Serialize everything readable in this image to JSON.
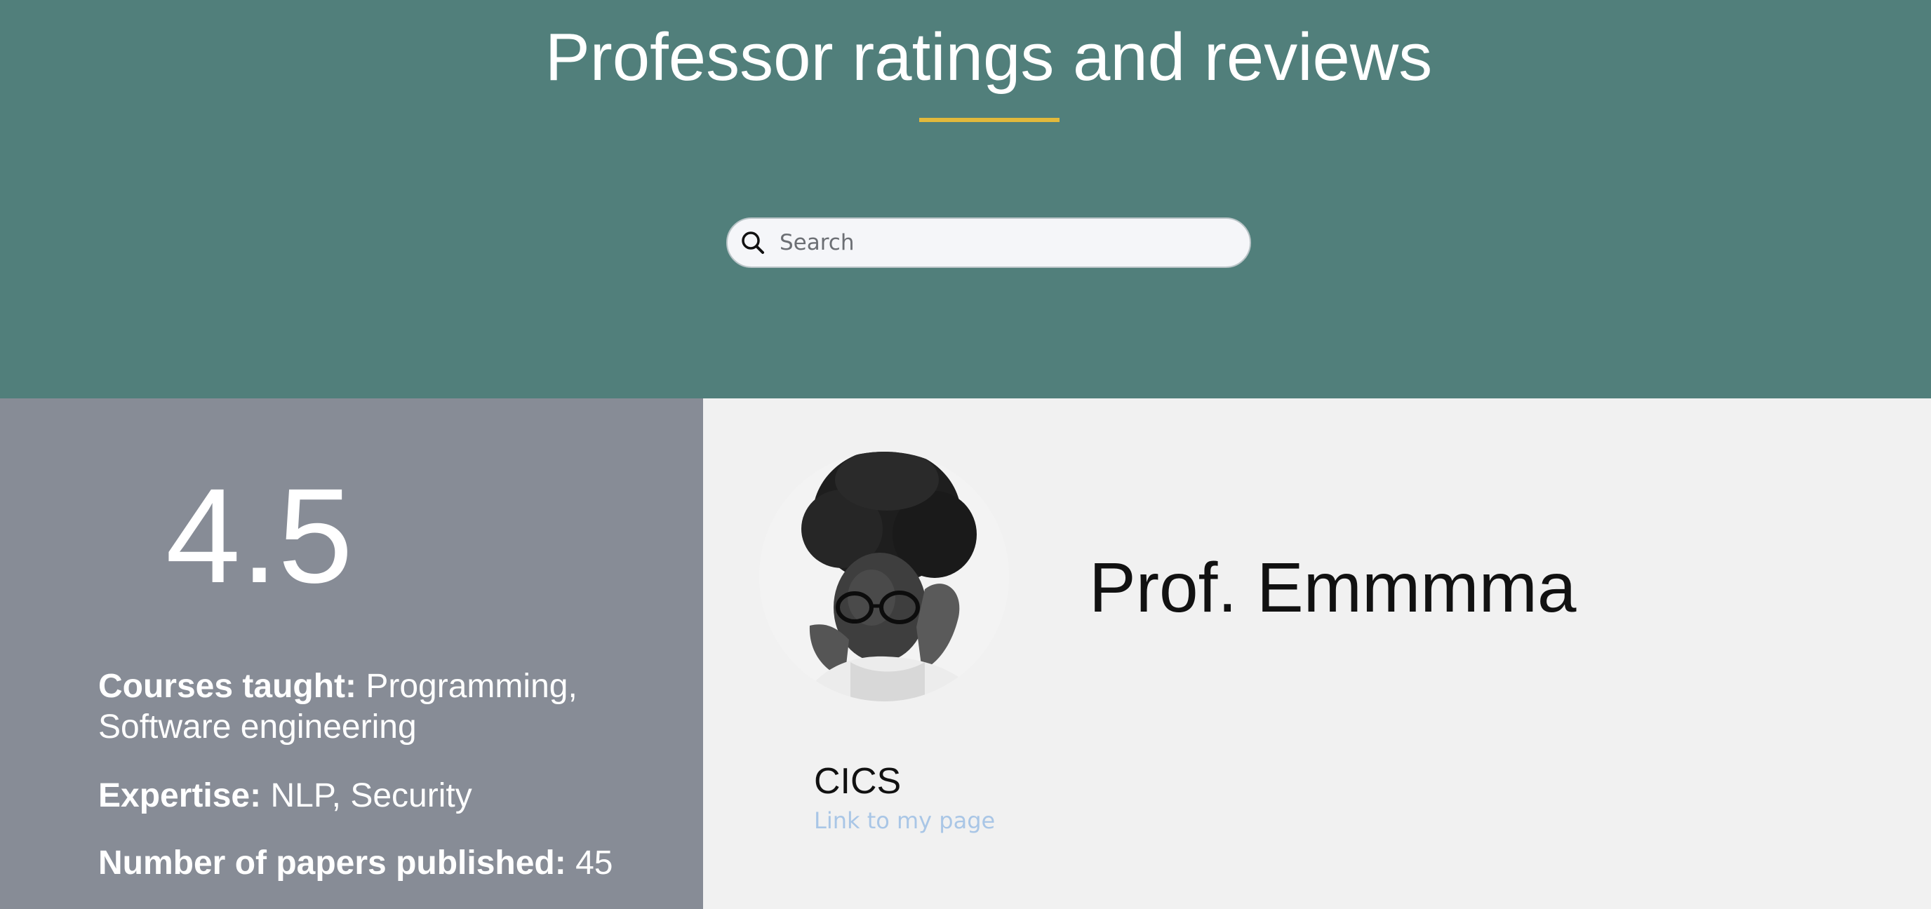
{
  "header": {
    "title": "Professor ratings and reviews",
    "accent_color": "#e2b93b",
    "background_color": "#517f7b"
  },
  "search": {
    "placeholder": "Search",
    "value": "",
    "icon": "search-icon"
  },
  "summary": {
    "rating": "4.5",
    "courses_label": "Courses taught:",
    "courses_value": "Programming, Software engineering",
    "expertise_label": "Expertise:",
    "expertise_value": "NLP, Security",
    "papers_label": "Number of papers published:",
    "papers_value": "45"
  },
  "profile": {
    "name": "Prof. Emmmma",
    "department": "CICS",
    "link_text": "Link to my page",
    "link_color": "#a9c6e6"
  }
}
